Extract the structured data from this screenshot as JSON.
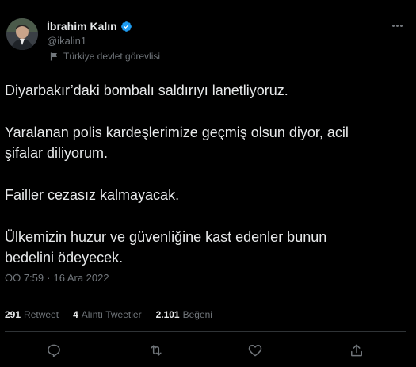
{
  "author": {
    "display_name": "İbrahim Kalın",
    "handle": "@ikalin1",
    "label": "Türkiye devlet görevlisi"
  },
  "tweet": {
    "paragraphs": [
      "Diyarbakır’daki bombalı saldırıyı lanetliyoruz.",
      "Yaralanan polis kardeşlerimize geçmiş olsun diyor, acil\nşifalar diliyorum.",
      "Failler cezasız kalmayacak.",
      "Ülkemizin huzur ve güvenliğine kast edenler bunun\nbedelini ödeyecek."
    ],
    "time": "ÖÖ 7:59",
    "separator": "·",
    "date": "16 Ara 2022"
  },
  "stats": {
    "retweets_count": "291",
    "retweets_label": "Retweet",
    "quotes_count": "4",
    "quotes_label": "Alıntı Tweetler",
    "likes_count": "2.101",
    "likes_label": "Beğeni"
  },
  "icons": {
    "verified": "verified-badge-icon",
    "label": "flag-icon",
    "more": "more-options-icon",
    "reply": "reply-icon",
    "retweet": "retweet-icon",
    "like": "like-icon",
    "share": "share-icon"
  },
  "colors": {
    "background": "#000000",
    "text": "#e7e9ea",
    "secondary": "#71767b",
    "verified": "#1d9bf0",
    "divider": "#2f3336"
  }
}
